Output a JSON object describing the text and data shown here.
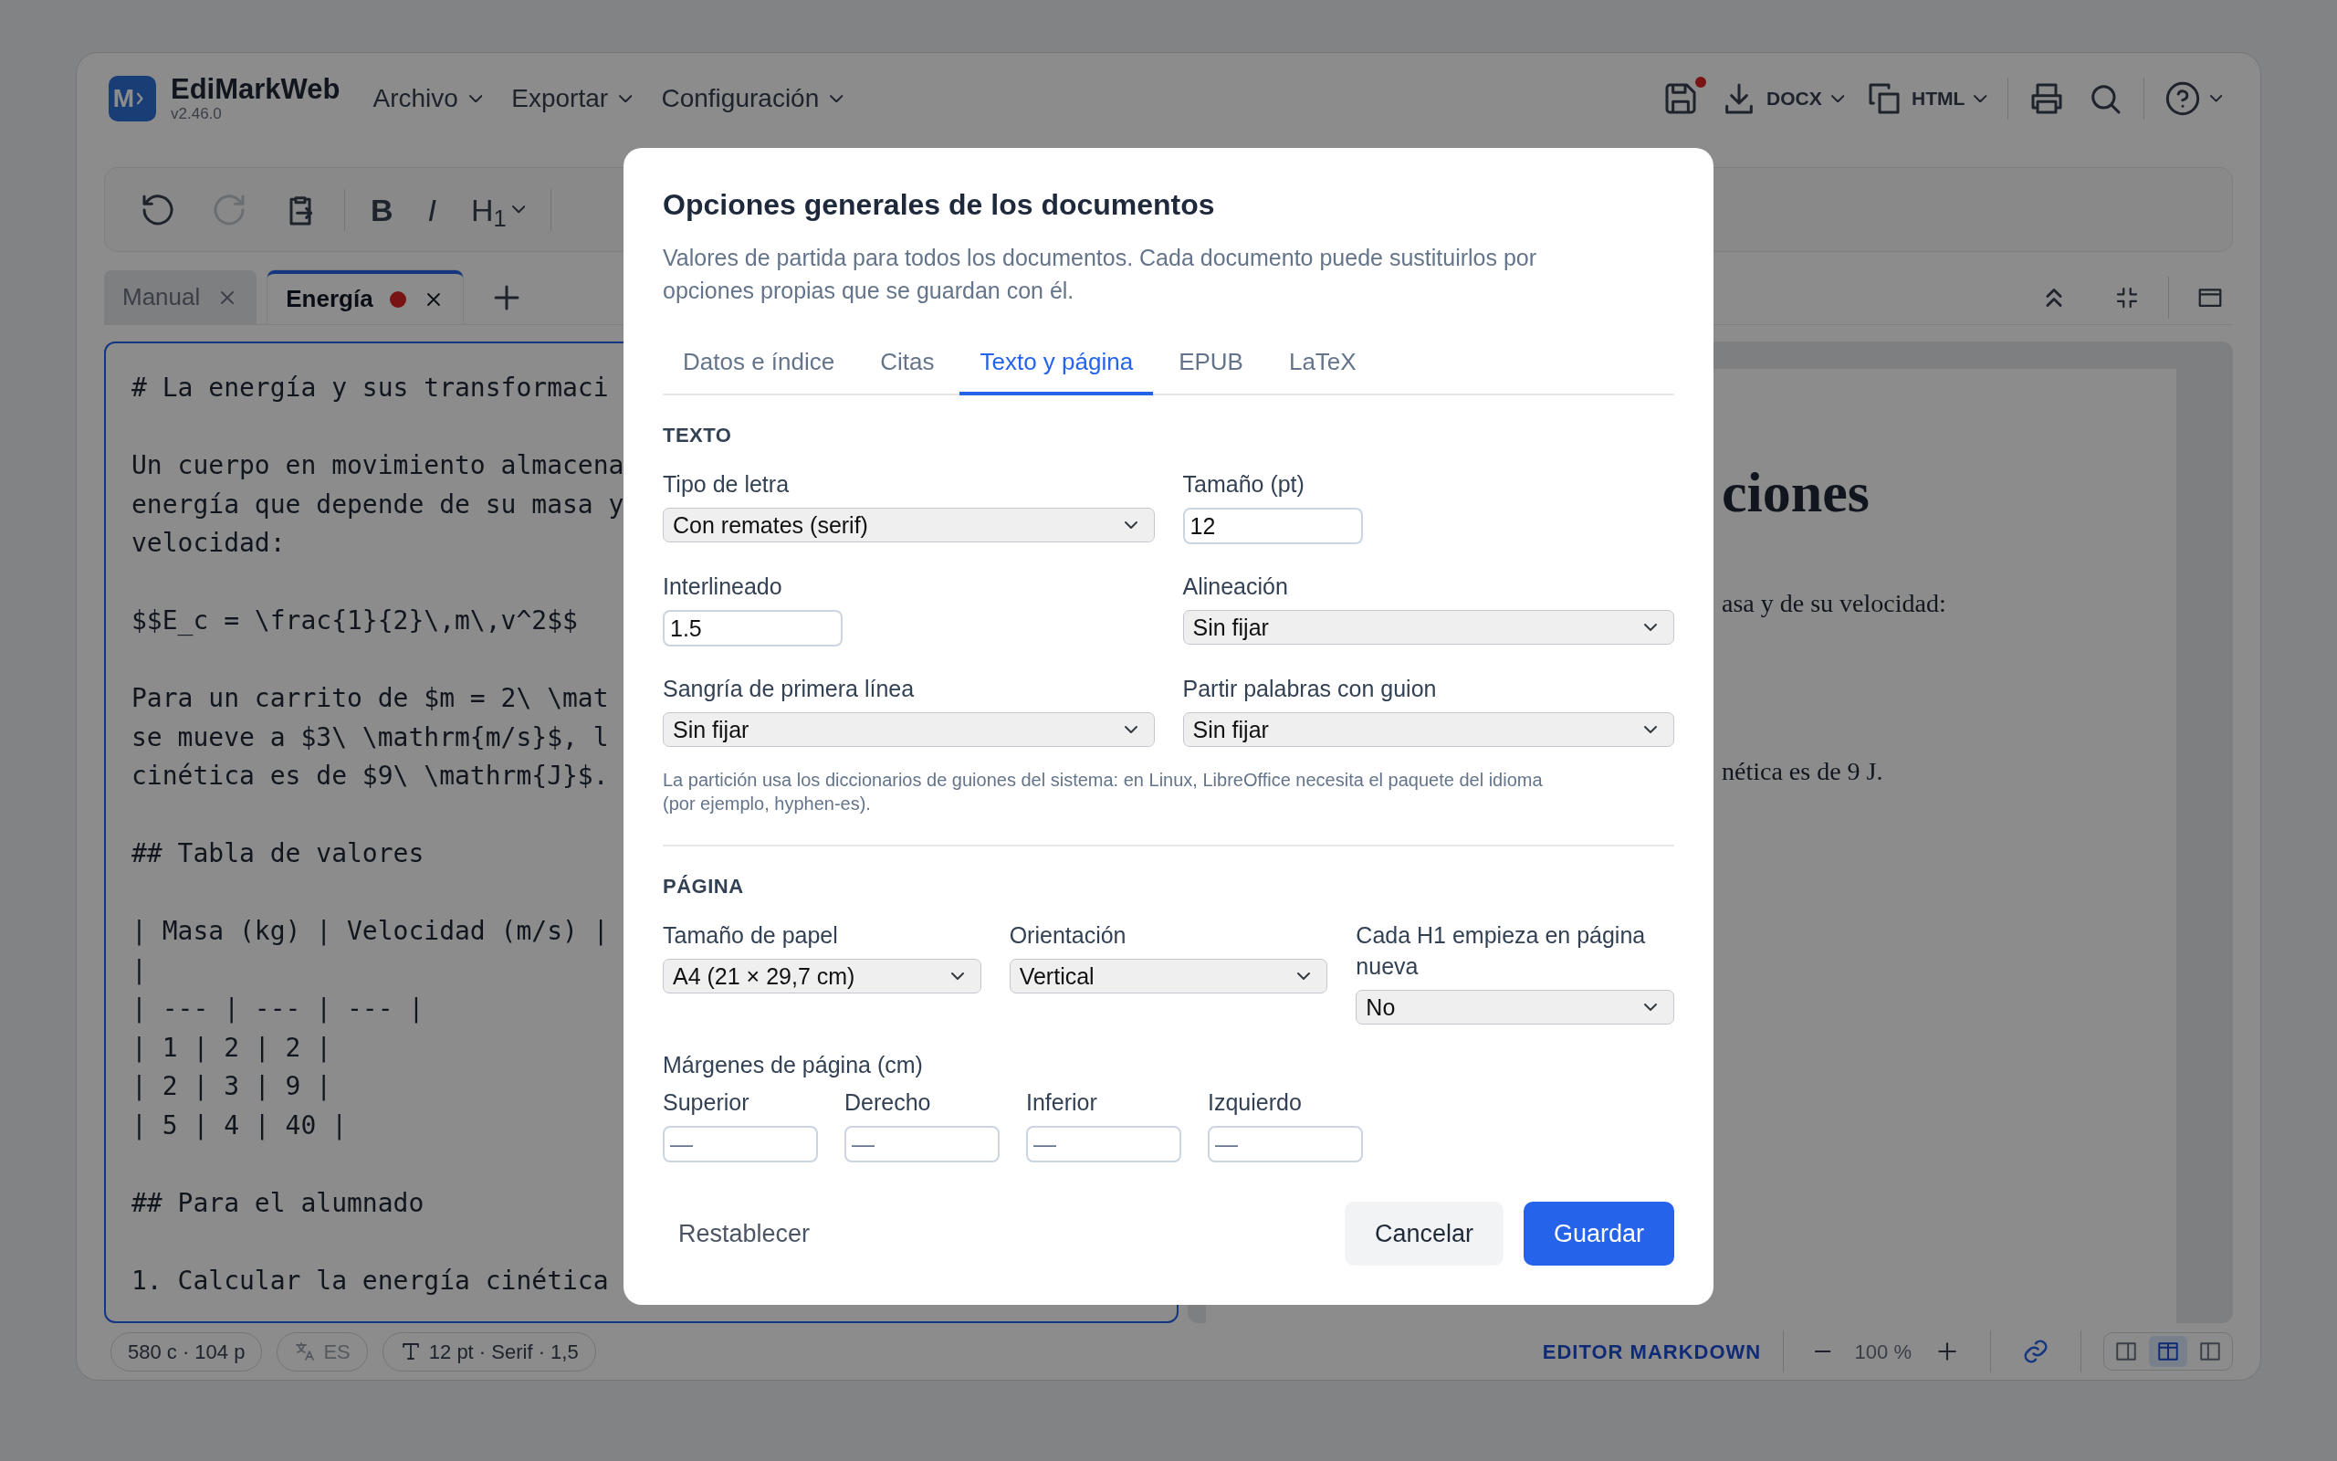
{
  "app": {
    "logo": "M",
    "name": "EdiMarkWeb",
    "version": "v2.46.0",
    "unsaved": true
  },
  "menus": [
    {
      "label": "Archivo"
    },
    {
      "label": "Exportar"
    },
    {
      "label": "Configuración"
    }
  ],
  "header_actions": [
    {
      "kind": "save"
    },
    {
      "kind": "download",
      "label": "DOCX"
    },
    {
      "kind": "copy",
      "label": "HTML"
    },
    {
      "kind": "divider"
    },
    {
      "kind": "print"
    },
    {
      "kind": "search"
    },
    {
      "kind": "divider"
    },
    {
      "kind": "help"
    }
  ],
  "toolbar": [
    {
      "kind": "undo",
      "disabled": false
    },
    {
      "kind": "redo",
      "disabled": true
    },
    {
      "kind": "paste",
      "disabled": false
    },
    {
      "kind": "divider"
    },
    {
      "kind": "bold",
      "label": "B"
    },
    {
      "kind": "italic",
      "label": "I"
    },
    {
      "kind": "heading",
      "label": "H$_{1}$"
    },
    {
      "kind": "divider"
    }
  ],
  "doc_tabs": [
    {
      "label": "Manual",
      "selected": false,
      "modified": false
    },
    {
      "label": "Energía",
      "selected": true,
      "modified": true
    }
  ],
  "editor": {
    "focused": true,
    "blocks": [
      [
        "# La energía y sus transformaci"
      ],
      [
        "Un cuerpo en movimiento almacena",
        "energía que depende de su masa y",
        "velocidad:"
      ],
      [
        "$$E_c = \\frac{1}{2}\\,m\\,v^2$$"
      ],
      [
        "Para un carrito de $m = 2\\ \\mat",
        "se mueve a $3\\ \\mathrm{m/s}$, l",
        "cinética es de $9\\ \\mathrm{J}$."
      ],
      [
        "## Tabla de valores"
      ],
      [
        "| Masa (kg) | Velocidad (m/s) |",
        "|",
        "| --- | --- | --- |",
        "| 1 | 2 | 2 |",
        "| 2 | 3 | 9 |",
        "| 5 | 4 | 40 |"
      ],
      [
        "## Para el alumnado"
      ],
      [
        "1. Calcular la energía cinética"
      ]
    ]
  },
  "preview": {
    "heading": "ciones",
    "lines": [
      "asa y de su velocidad:",
      "nética es de 9 J."
    ]
  },
  "status_bar": {
    "stats": "580 c · 104 p",
    "language": {
      "label": "ES",
      "disabled": true
    },
    "format": "12 pt · Serif · 1,5",
    "mode": "EDITOR MARKDOWN",
    "zoom": "100 %",
    "link_active": true,
    "layouts": [
      {
        "kind": "editor",
        "selected": false
      },
      {
        "kind": "split",
        "selected": true
      },
      {
        "kind": "preview",
        "selected": false
      }
    ]
  },
  "dialog": {
    "title": "Opciones generales de los documentos",
    "description": "Valores de partida para todos los documentos. Cada documento puede sustituirlos por opciones propias que se guardan con él.",
    "tabs": [
      {
        "label": "Datos e índice",
        "selected": false
      },
      {
        "label": "Citas",
        "selected": false
      },
      {
        "label": "Texto y página",
        "selected": true
      },
      {
        "label": "EPUB",
        "selected": false
      },
      {
        "label": "LaTeX",
        "selected": false
      }
    ],
    "sections": [
      {
        "heading": "TEXTO",
        "fields": [
          {
            "kind": "select",
            "label": "Tipo de letra",
            "value": "Con remates (serif)"
          },
          {
            "kind": "number",
            "label": "Tamaño (pt)",
            "value": "12"
          },
          {
            "kind": "number",
            "label": "Interlineado",
            "value": "1.5"
          },
          {
            "kind": "select",
            "label": "Alineación",
            "value": "Sin fijar"
          },
          {
            "kind": "select",
            "label": "Sangría de primera línea",
            "value": "Sin fijar"
          },
          {
            "kind": "select",
            "label": "Partir palabras con guion",
            "value": "Sin fijar"
          }
        ],
        "note": "La partición usa los diccionarios de guiones del sistema: en Linux, LibreOffice necesita el paquete del idioma (por ejemplo, hyphen-es)."
      },
      {
        "heading": "PÁGINA",
        "fields": [
          {
            "kind": "select",
            "label": "Tamaño de papel",
            "value": "A4 (21 × 29,7 cm)"
          },
          {
            "kind": "select",
            "label": "Orientación",
            "value": "Vertical"
          },
          {
            "kind": "select",
            "label": "Cada H1 empieza en página nueva",
            "value": "No"
          }
        ],
        "group": {
          "label": "Márgenes de página (cm)",
          "fields": [
            {
              "label": "Superior",
              "placeholder": "—"
            },
            {
              "label": "Derecho",
              "placeholder": "—"
            },
            {
              "label": "Inferior",
              "placeholder": "—"
            },
            {
              "label": "Izquierdo",
              "placeholder": "—"
            }
          ]
        }
      }
    ],
    "footer": {
      "reset": "Restablecer",
      "cancel": "Cancelar",
      "save": "Guardar"
    }
  }
}
